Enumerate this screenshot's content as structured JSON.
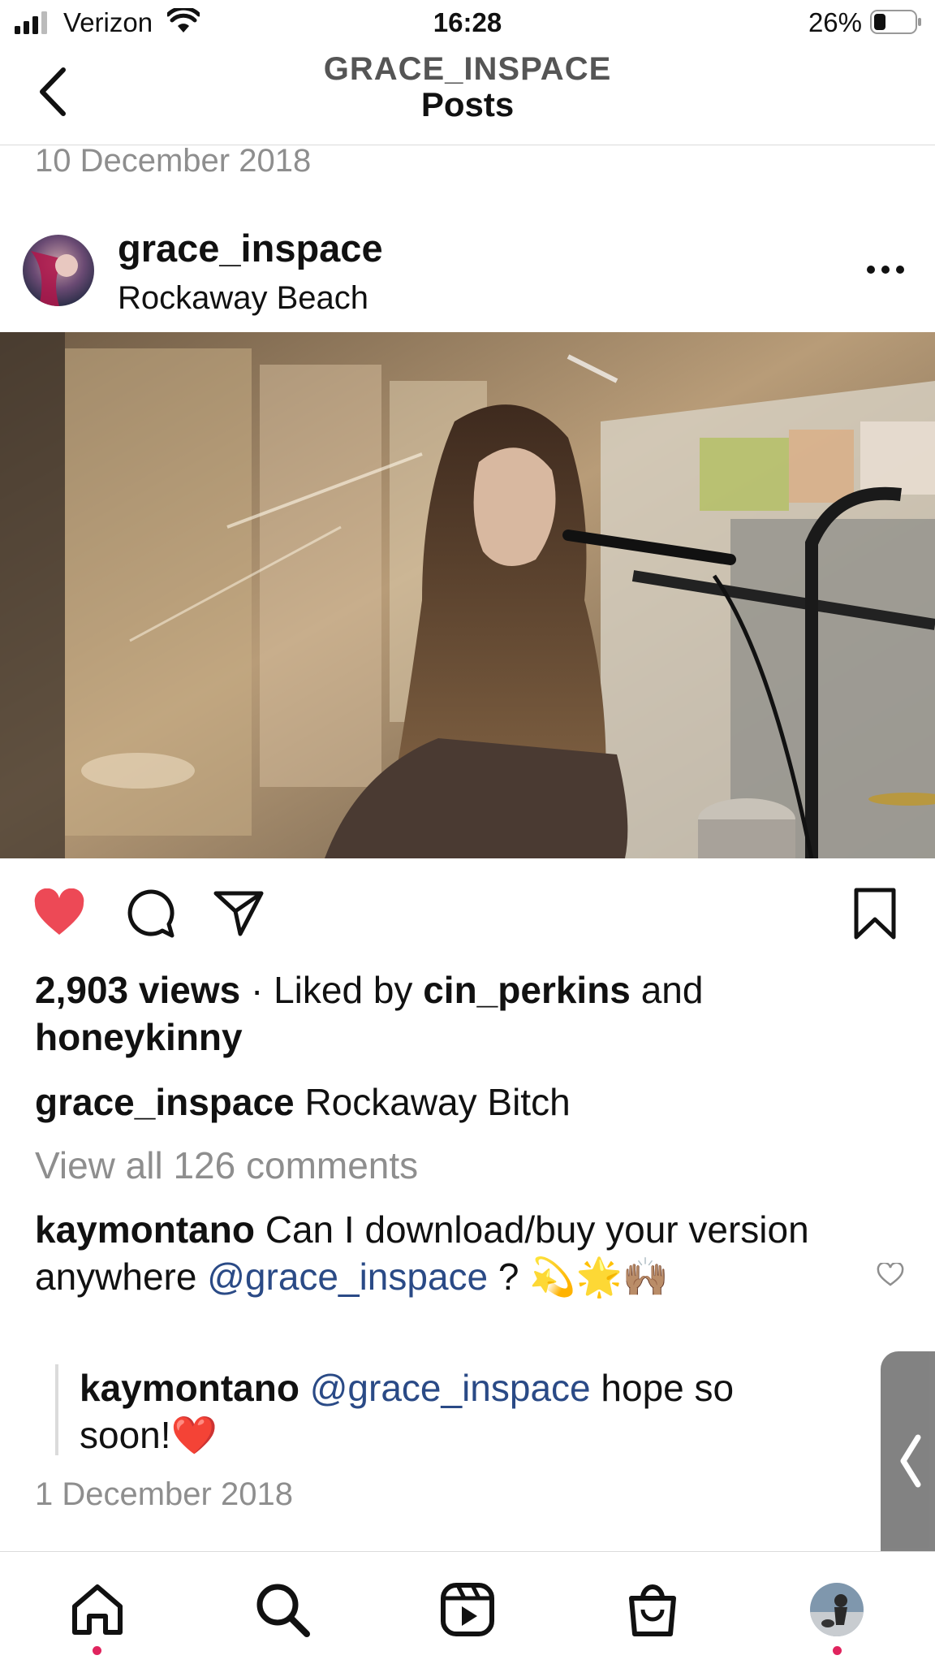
{
  "status_bar": {
    "carrier": "Verizon",
    "time": "16:28",
    "battery": "26%"
  },
  "header": {
    "username": "GRACE_INSPACE",
    "title": "Posts"
  },
  "previous_post_date": "10 December 2018",
  "post": {
    "username": "grace_inspace",
    "location": "Rockaway Beach",
    "views": "2,903 views",
    "separator": "·",
    "liked_by_prefix": "Liked by",
    "liked_by_user1": "cin_perkins",
    "liked_by_and": "and",
    "liked_by_user2": "honeykinny",
    "caption_user": "grace_inspace",
    "caption_text": "Rockaway Bitch",
    "view_all_comments": "View all 126 comments",
    "comments": [
      {
        "user": "kaymontano",
        "text_start": "Can I download/buy your version anywhere",
        "mention": "@grace_inspace",
        "text_end": "? 💫🌟🙌🏽"
      }
    ],
    "reply": {
      "user": "kaymontano",
      "mention": "@grace_inspace",
      "text": "hope so soon!❤️"
    },
    "date": "1 December 2018"
  },
  "colors": {
    "like_red": "#ed4956",
    "mention_blue": "#2a4a86",
    "muted_gray": "#8e8e8e",
    "notification_dot": "#e0245e"
  },
  "icons": [
    "back-chevron-icon",
    "more-options-icon",
    "heart-filled-icon",
    "comment-bubble-icon",
    "share-paper-plane-icon",
    "bookmark-icon",
    "heart-outline-icon",
    "home-icon",
    "search-icon",
    "reels-icon",
    "shop-bag-icon",
    "profile-avatar"
  ]
}
